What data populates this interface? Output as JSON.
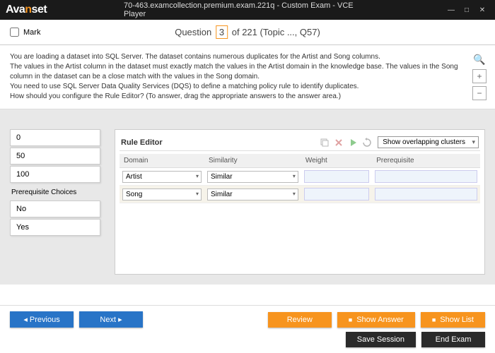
{
  "window": {
    "logo_a": "Ava",
    "logo_b": "n",
    "logo_c": "set",
    "title": "70-463.examcollection.premium.exam.221q - Custom Exam - VCE Player"
  },
  "header": {
    "mark_label": "Mark",
    "question_word": "Question",
    "current": "3",
    "of_text": "of 221",
    "topic": "(Topic ..., Q57)"
  },
  "question": {
    "line1": "You are loading a dataset into SQL Server. The dataset contains numerous duplicates for the Artist and Song columns.",
    "line2": "The values in the Artist column in the dataset must exactly match the values in the Artist domain in the knowledge base. The values in the Song column in the dataset can be a close match with the values in the Song domain.",
    "line3": "You need to use SQL Server Data Quality Services (DQS) to define a matching policy rule to identify duplicates.",
    "line4": "How should you configure the Rule Editor? (To answer, drag the appropriate answers to the answer area.)"
  },
  "choices": {
    "numbers": [
      "0",
      "50",
      "100"
    ],
    "prereq_header": "Prerequisite Choices",
    "bools": [
      "No",
      "Yes"
    ]
  },
  "editor": {
    "title": "Rule Editor",
    "dropdown": "Show overlapping clusters",
    "cols": {
      "domain": "Domain",
      "similarity": "Similarity",
      "weight": "Weight",
      "prereq": "Prerequisite"
    },
    "rows": [
      {
        "domain": "Artist",
        "similarity": "Similar"
      },
      {
        "domain": "Song",
        "similarity": "Similar"
      }
    ]
  },
  "footer": {
    "previous": "Previous",
    "next": "Next",
    "review": "Review",
    "show_answer": "Show Answer",
    "show_list": "Show List",
    "save_session": "Save Session",
    "end_exam": "End Exam"
  }
}
